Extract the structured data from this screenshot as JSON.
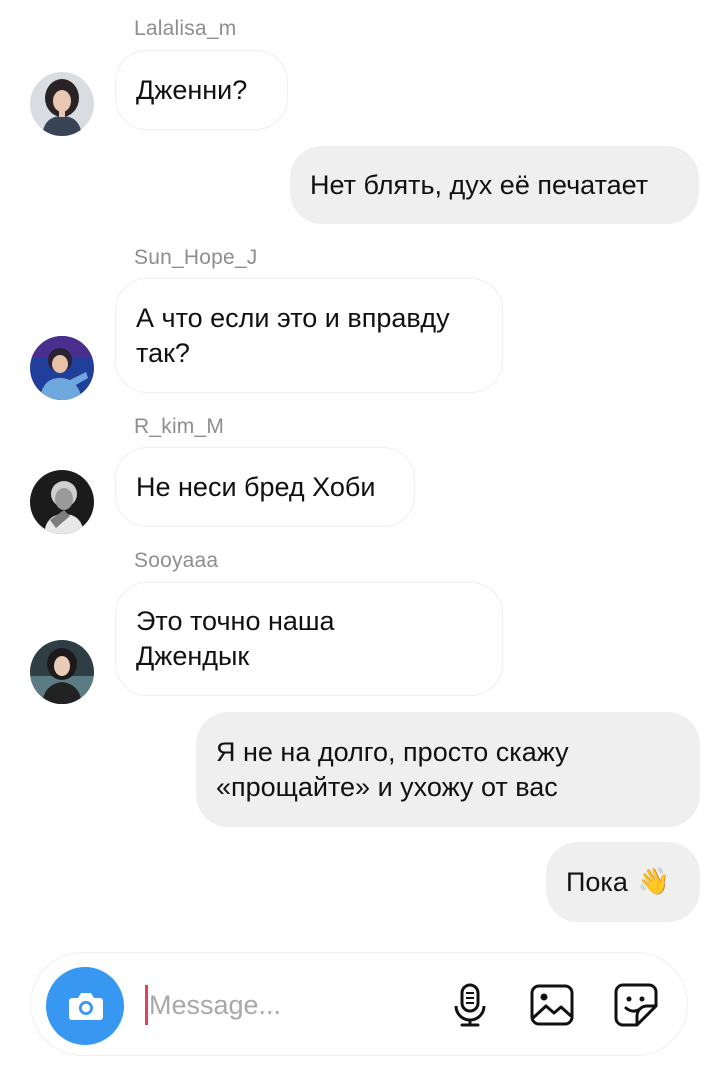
{
  "messages": [
    {
      "sender": "Lalalisa_m",
      "text": "Дженни?"
    },
    {
      "text": "Нет блять, дух её печатает"
    },
    {
      "sender": "Sun_Hope_J",
      "text": "А что если это и вправду\nтак?"
    },
    {
      "sender": "R_kim_M",
      "text": "Не неси бред Хоби"
    },
    {
      "sender": "Sooyaaa",
      "text": "Это точно наша\nДжендык"
    },
    {
      "text": "Я не на долго, просто скажу\n«прощайте» и ухожу от вас"
    },
    {
      "text": "Пока",
      "emoji": "👋"
    }
  ],
  "composer": {
    "placeholder": "Message...",
    "value": "",
    "icons": [
      "camera-icon",
      "microphone-icon",
      "gallery-icon",
      "sticker-icon"
    ]
  },
  "colors": {
    "accent": "#3897f0",
    "caret": "#e4405f",
    "outgoing_bubble": "#efefef",
    "sender_name": "#8e8e8e"
  }
}
